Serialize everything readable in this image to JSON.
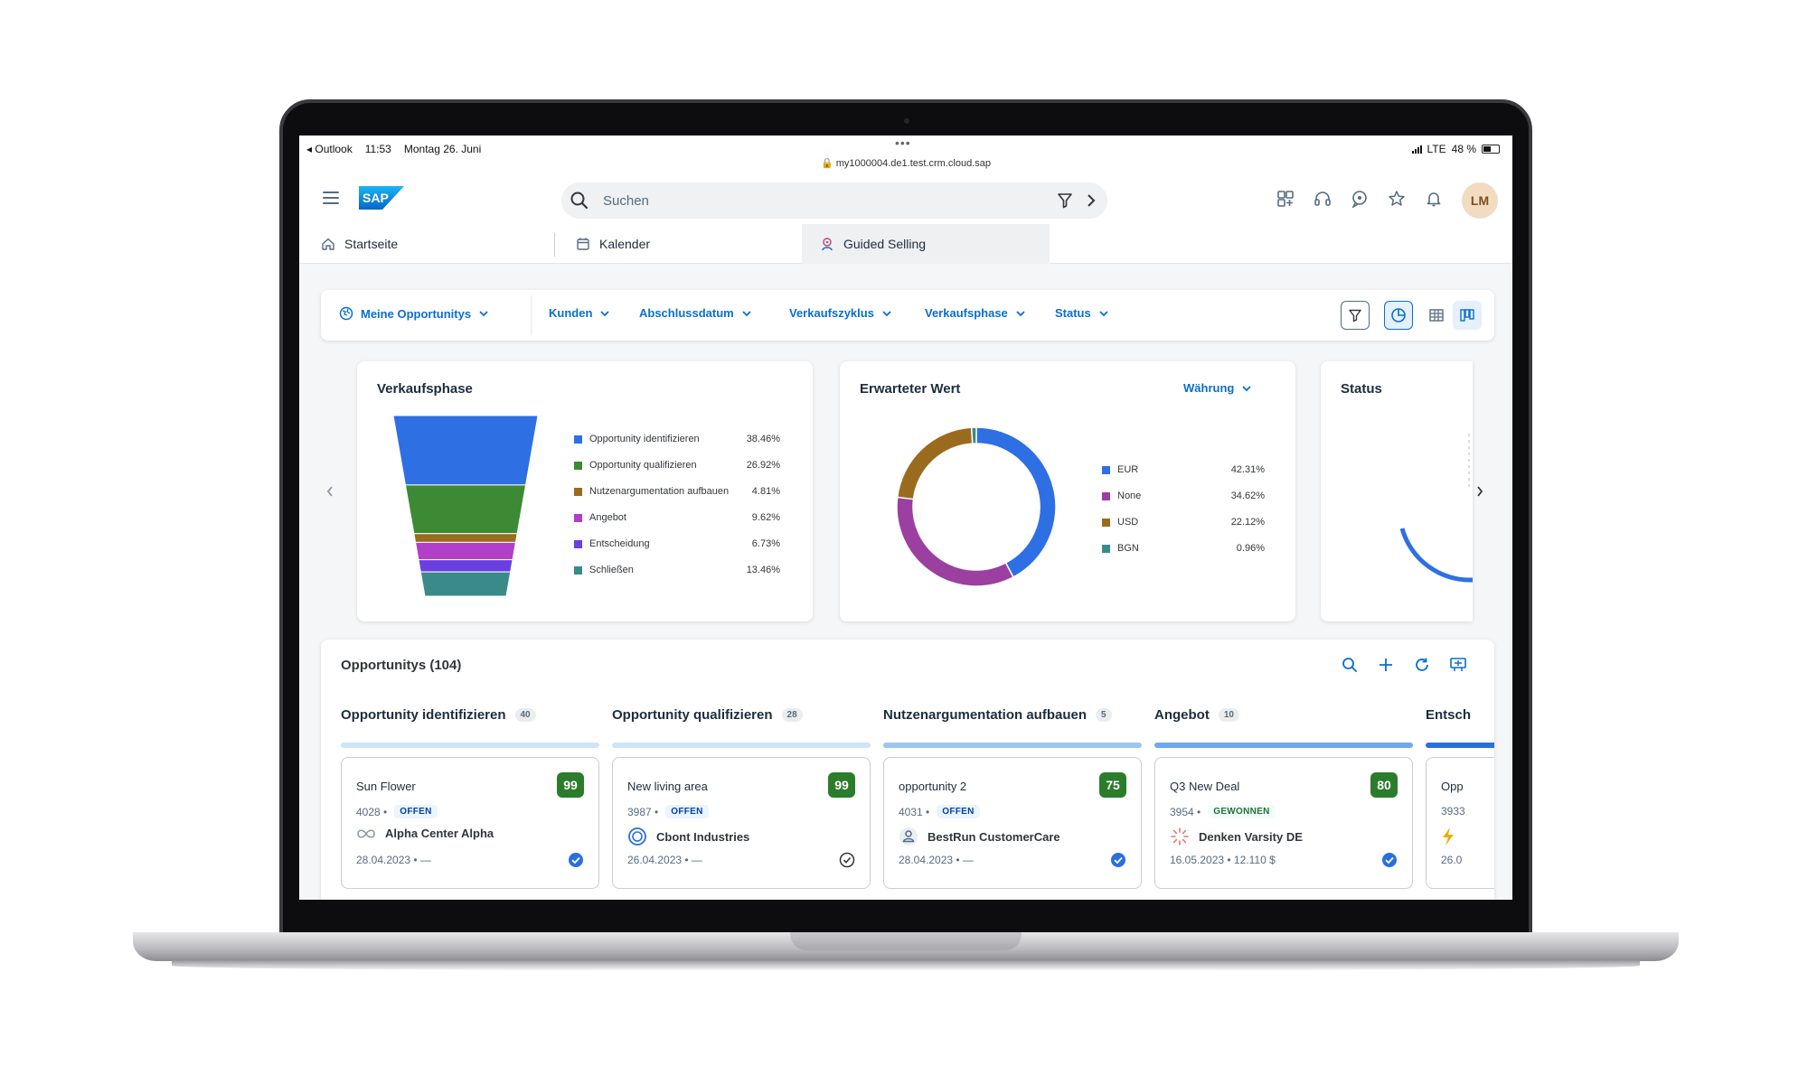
{
  "device_status": {
    "back_app": "◂ Outlook",
    "time": "11:53",
    "date": "Montag 26. Juni",
    "url": "my1000004.de1.test.crm.cloud.sap",
    "network": "LTE",
    "battery": "48 %",
    "battery_level": 0.48
  },
  "shell": {
    "logo_text": "SAP",
    "search_placeholder": "Suchen",
    "avatar_initials": "LM",
    "action_icons": [
      "apps-icon",
      "headset-icon",
      "chat-icon",
      "star-icon",
      "bell-icon"
    ]
  },
  "tabs": [
    {
      "label": "Startseite",
      "icon": "home-icon",
      "active": false
    },
    {
      "label": "Kalender",
      "icon": "calendar-icon",
      "active": false
    },
    {
      "label": "Guided Selling",
      "icon": "guided-selling-icon",
      "active": true
    }
  ],
  "filters": {
    "primary": "Meine Opportunitys",
    "items": [
      "Kunden",
      "Abschlussdatum",
      "Verkaufszyklus",
      "Verkaufsphase",
      "Status"
    ]
  },
  "charts": {
    "sales_phase_title": "Verkaufsphase",
    "expected_value_title": "Erwarteter Wert",
    "currency_dropdown": "Währung",
    "status_title": "Status"
  },
  "chart_data": [
    {
      "type": "funnel",
      "title": "Verkaufsphase",
      "categories": [
        "Opportunity identifizieren",
        "Opportunity qualifizieren",
        "Nutzenargumentation aufbauen",
        "Angebot",
        "Entscheidung",
        "Schließen"
      ],
      "values": [
        38.46,
        26.92,
        4.81,
        9.62,
        6.73,
        13.46
      ],
      "labels": [
        "38.46%",
        "26.92%",
        "4.81%",
        "9.62%",
        "6.73%",
        "13.46%"
      ],
      "colors": [
        "#2f6fe4",
        "#3d8a35",
        "#9a6b1e",
        "#b23fc7",
        "#6a3fe0",
        "#3a8a8a"
      ],
      "legend": "right"
    },
    {
      "type": "donut",
      "title": "Erwarteter Wert",
      "categories": [
        "EUR",
        "None",
        "USD",
        "BGN"
      ],
      "values": [
        42.31,
        34.62,
        22.12,
        0.96
      ],
      "labels": [
        "42.31%",
        "34.62%",
        "22.12%",
        "0.96%"
      ],
      "colors": [
        "#2f6fe4",
        "#9b3fa0",
        "#9a6b1e",
        "#3a8a8a"
      ],
      "legend": "right"
    }
  ],
  "opportunities": {
    "title": "Opportunitys (104)",
    "columns": [
      {
        "label": "Opportunity identifizieren",
        "count": "40",
        "bar_color": "#cfe4f8",
        "card": {
          "name": "Sun Flower",
          "score": "99",
          "id": "4028 •",
          "status": "OFFEN",
          "status_type": "open",
          "account": "Alpha Center Alpha",
          "account_icon": "infinity-icon",
          "date": "28.04.2023 • —",
          "check": "filled"
        }
      },
      {
        "label": "Opportunity qualifizieren",
        "count": "28",
        "bar_color": "#cfe4f8",
        "card": {
          "name": "New living area",
          "score": "99",
          "id": "3987 •",
          "status": "OFFEN",
          "status_type": "open",
          "account": "Cbont Industries",
          "account_icon": "ring-icon",
          "date": "26.04.2023 • —",
          "check": "outline"
        }
      },
      {
        "label": "Nutzenargumentation aufbauen",
        "count": "5",
        "bar_color": "#9ec7f0",
        "card": {
          "name": "opportunity 2",
          "score": "75",
          "id": "4031 •",
          "status": "OFFEN",
          "status_type": "open",
          "account": "BestRun CustomerCare",
          "account_icon": "person-icon",
          "date": "28.04.2023 • —",
          "check": "filled"
        }
      },
      {
        "label": "Angebot",
        "count": "10",
        "bar_color": "#6eaaea",
        "card": {
          "name": "Q3 New Deal",
          "score": "80",
          "id": "3954 •",
          "status": "GEWONNEN",
          "status_type": "won",
          "account": "Denken Varsity DE",
          "account_icon": "sunburst-icon",
          "date": "16.05.2023 • 12.110 $",
          "check": "filled"
        }
      },
      {
        "label": "Entsch",
        "count": "",
        "bar_color": "#2a6fe0",
        "card": {
          "name": "Opp",
          "score": "",
          "id": "3933",
          "status": "",
          "status_type": "",
          "account": "",
          "account_icon": "lightning-icon",
          "date": "26.0",
          "check": ""
        }
      }
    ]
  }
}
